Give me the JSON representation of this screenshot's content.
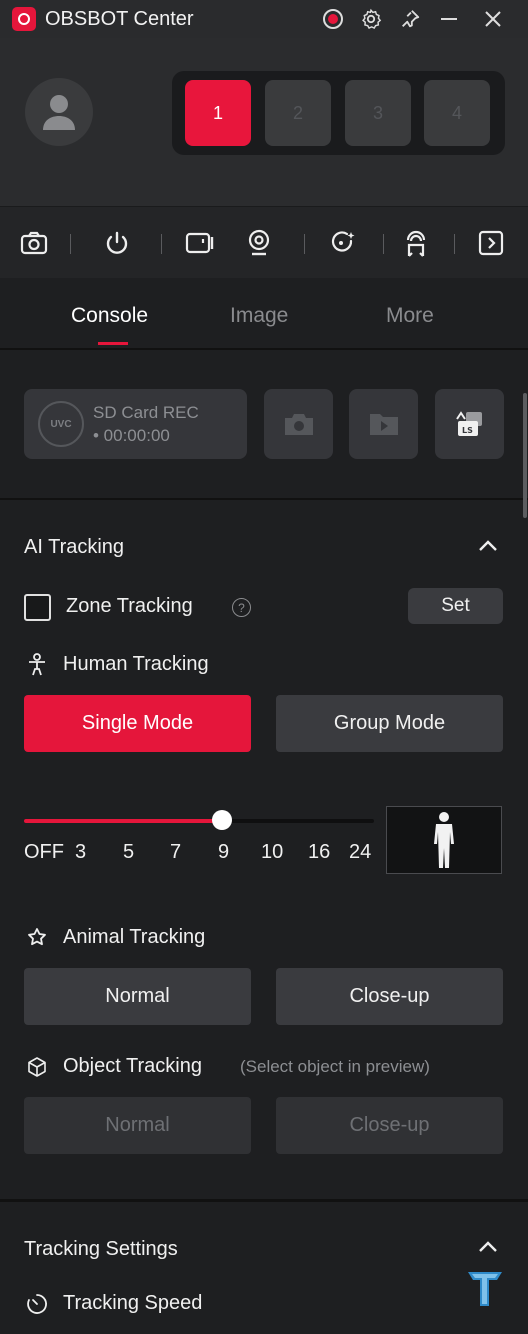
{
  "window": {
    "title": "OBSBOT Center"
  },
  "titlebar_icons": [
    "record-indicator-icon",
    "gear-icon",
    "pin-icon",
    "minimize-icon",
    "close-icon"
  ],
  "device_slots": [
    "1",
    "2",
    "3",
    "4"
  ],
  "active_slot": "1",
  "toolbar_icons": [
    "camera-icon",
    "power-icon",
    "video-camera-icon",
    "webcam-icon",
    "refresh-sparkle-icon",
    "tracker-icon",
    "sidebar-toggle-icon"
  ],
  "tabs": {
    "console": "Console",
    "image": "Image",
    "more": "More"
  },
  "recording": {
    "badge": "UVC",
    "label": "SD Card REC",
    "time": "• 00:00:00",
    "buttons": [
      "photo-button",
      "gallery-button",
      "ls-switch-button"
    ],
    "ls_text": "LS"
  },
  "ai_tracking": {
    "title": "AI Tracking",
    "zone_tracking": "Zone Tracking",
    "help": "?",
    "set": "Set",
    "human_tracking": "Human Tracking",
    "single_mode": "Single Mode",
    "group_mode": "Group Mode",
    "slider_ticks": [
      "OFF",
      "3",
      "5",
      "7",
      "9",
      "10",
      "16",
      "24"
    ],
    "slider_value": "9",
    "animal_tracking": "Animal Tracking",
    "animal_normal": "Normal",
    "animal_closeup": "Close-up",
    "object_tracking": "Object Tracking",
    "object_hint": "(Select object in preview)",
    "object_normal": "Normal",
    "object_closeup": "Close-up"
  },
  "tracking_settings": {
    "title": "Tracking Settings",
    "tracking_speed": "Tracking Speed"
  },
  "colors": {
    "accent": "#e5163b",
    "background": "#1e1f21",
    "panel": "#35363a"
  }
}
